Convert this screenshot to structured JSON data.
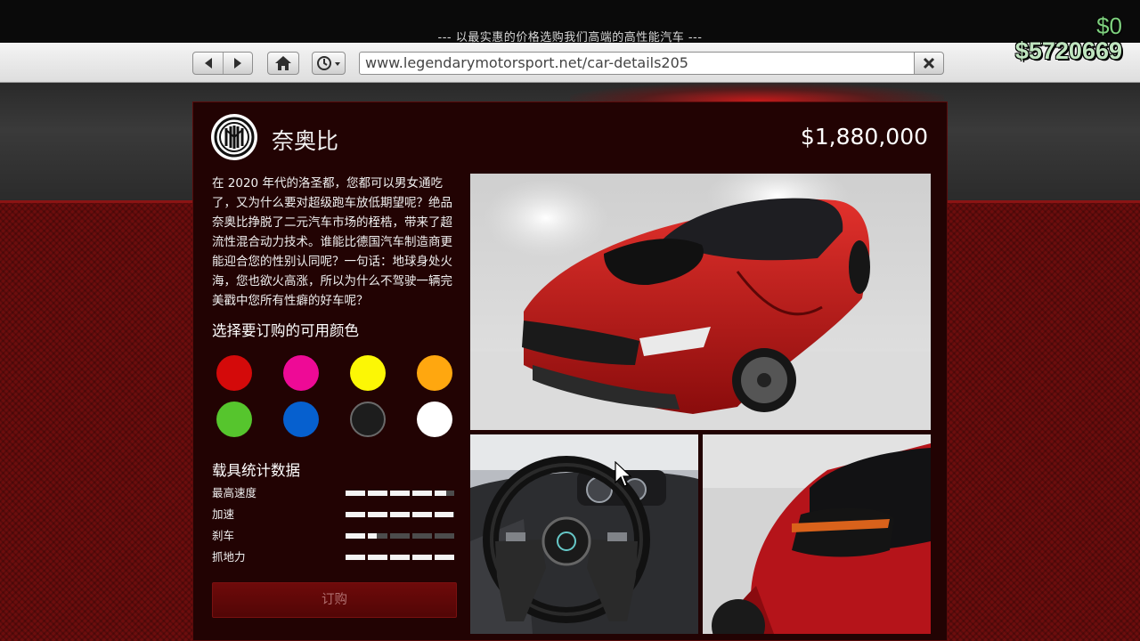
{
  "browser": {
    "title": "--- 以最实惠的价格选购我们高端的高性能汽车 ---",
    "url": "www.legendarymotorsport.net/car-details205"
  },
  "hud": {
    "cash": "$0",
    "bank": "$5720669"
  },
  "vehicle": {
    "name": "奈奥比",
    "price": "$1,880,000",
    "description": "在 2020 年代的洛圣都，您都可以男女通吃了，又为什么要对超级跑车放低期望呢？绝品奈奥比挣脱了二元汽车市场的桎梏，带来了超流性混合动力技术。谁能比德国汽车制造商更能迎合您的性别认同呢？一句话：地球身处火海，您也欲火高涨，所以为什么不驾驶一辆完美戳中您所有性癖的好车呢？",
    "colors_title": "选择要订购的可用颜色",
    "colors": [
      {
        "name": "red",
        "hex": "#d40a0a"
      },
      {
        "name": "magenta",
        "hex": "#ee0a96"
      },
      {
        "name": "yellow",
        "hex": "#fcf705"
      },
      {
        "name": "orange",
        "hex": "#ffa70f"
      },
      {
        "name": "green",
        "hex": "#56c52d"
      },
      {
        "name": "blue",
        "hex": "#0660cf"
      },
      {
        "name": "black",
        "hex": "#1d1d1d"
      },
      {
        "name": "white",
        "hex": "#ffffff"
      }
    ],
    "stats_title": "载具统计数据",
    "stats": [
      {
        "label": "最高速度",
        "level": 0.9
      },
      {
        "label": "加速",
        "level": 0.97
      },
      {
        "label": "刹车",
        "level": 0.28
      },
      {
        "label": "抓地力",
        "level": 1.0
      }
    ],
    "buy_label": "订购"
  },
  "theme": {
    "accent": "#d40a0a",
    "panel_bg": "#220303",
    "cash_green": "#7ed07e"
  }
}
